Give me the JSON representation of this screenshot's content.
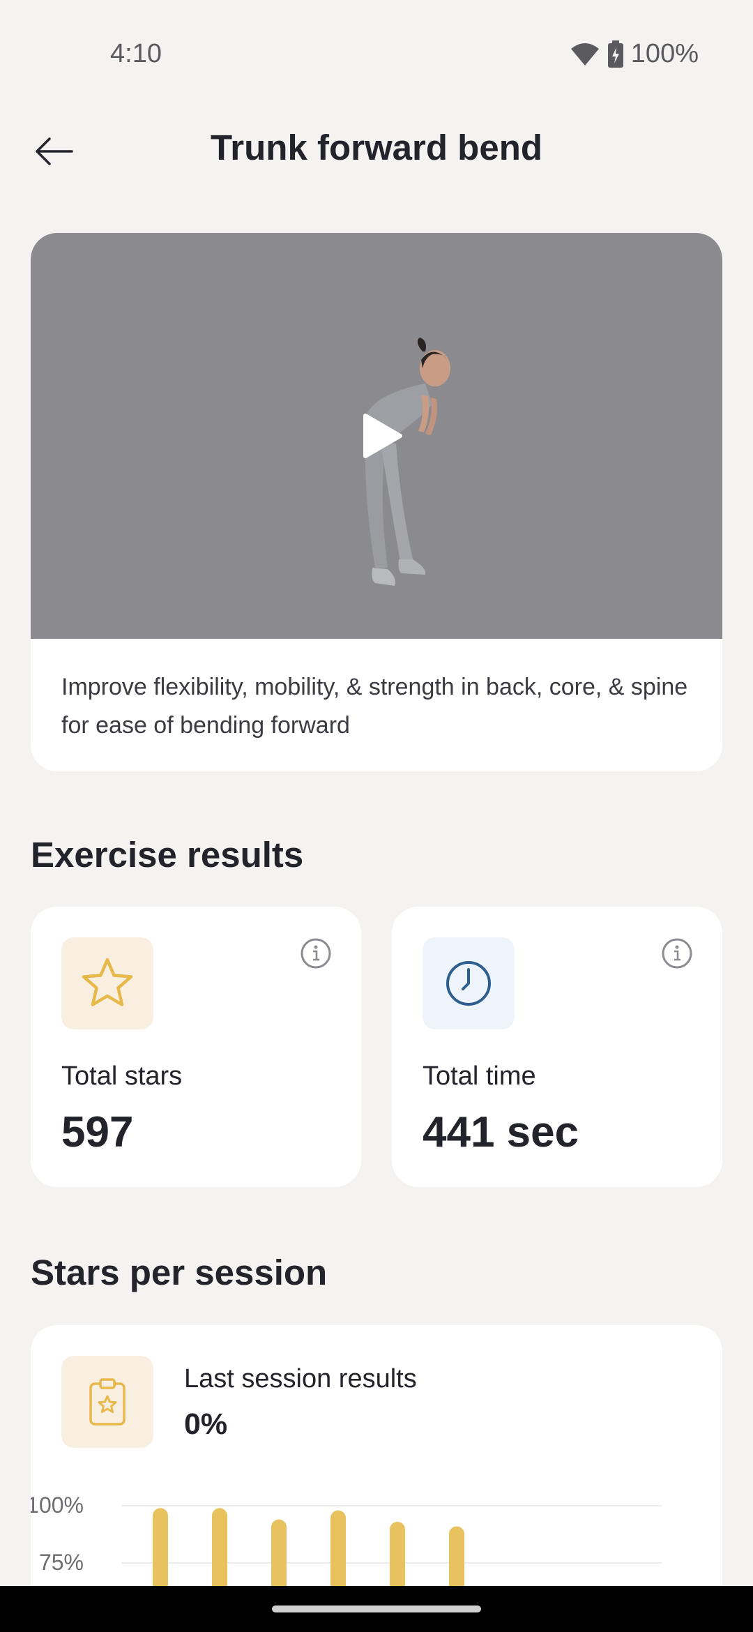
{
  "status_bar": {
    "time": "4:10",
    "battery": "100%"
  },
  "header": {
    "title": "Trunk forward bend",
    "back_icon": "arrow-left-icon"
  },
  "video": {
    "description": "Improve flexibility, mobility, & strength in back, core, & spine for ease of bending forward",
    "play_icon": "play-icon"
  },
  "exercise_results": {
    "title": "Exercise results",
    "stars": {
      "label": "Total stars",
      "value": "597",
      "icon": "star-icon"
    },
    "time": {
      "label": "Total time",
      "value": "441 sec",
      "icon": "clock-icon"
    }
  },
  "stars_per_session": {
    "title": "Stars per session",
    "last_label": "Last session results",
    "last_value": "0%",
    "icon": "clipboard-star-icon"
  },
  "chart_data": {
    "type": "bar",
    "y_ticks": [
      "100%",
      "75%"
    ],
    "values": [
      99,
      99,
      94,
      98,
      93,
      91
    ],
    "ylim": [
      75,
      100
    ],
    "color": "#e7c25e"
  },
  "colors": {
    "accent_gold": "#e7b84a",
    "accent_blue": "#2f5f8f",
    "background": "#f4f3f1"
  }
}
